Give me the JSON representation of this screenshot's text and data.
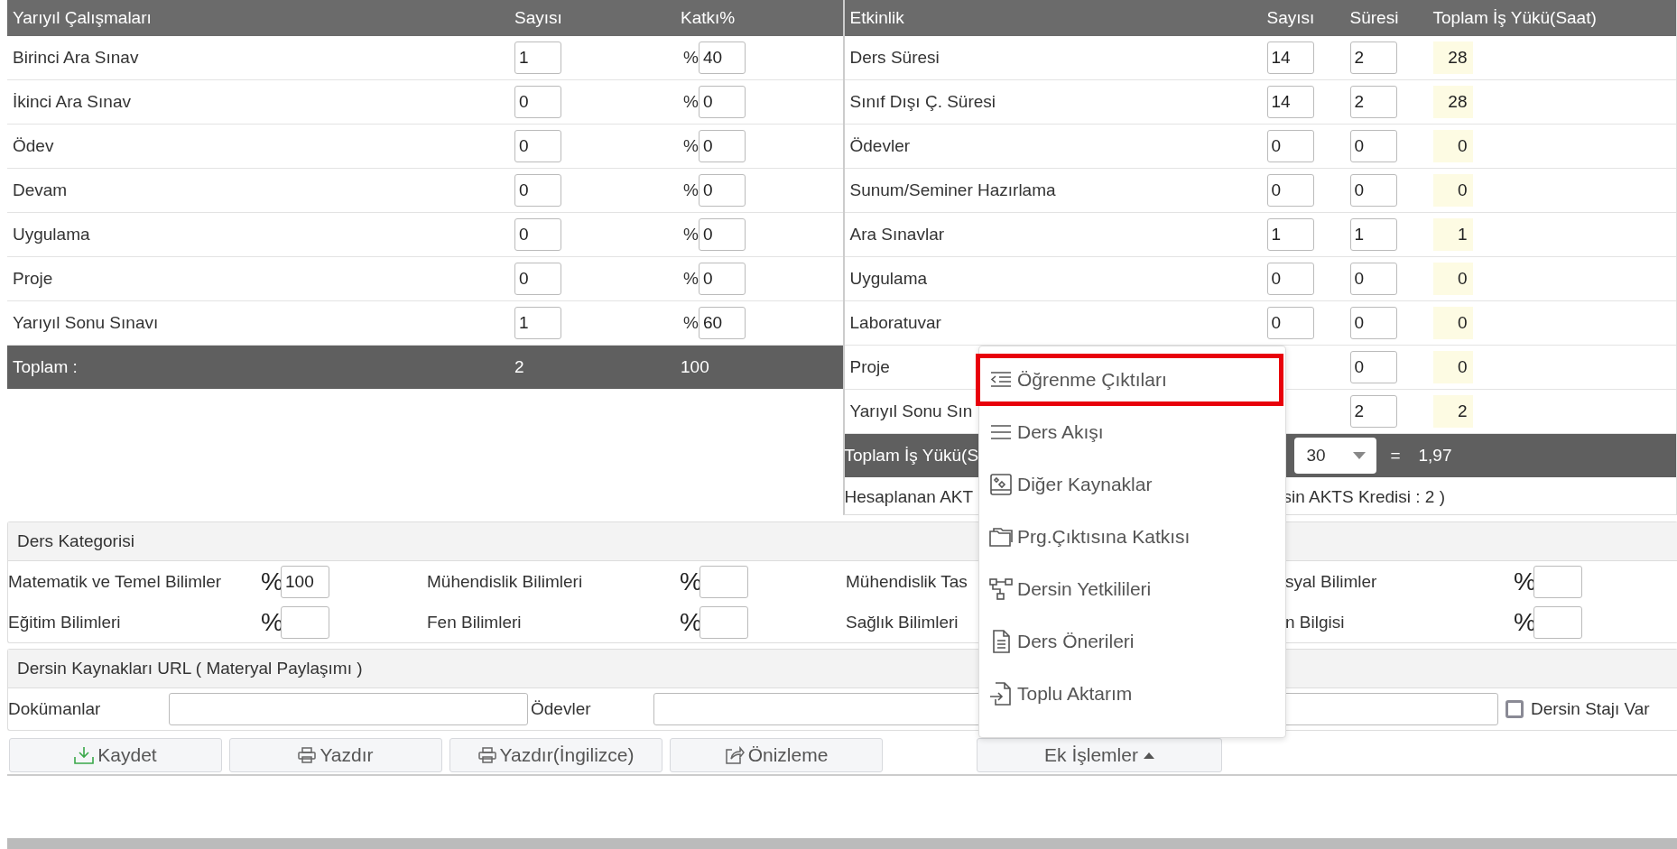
{
  "yariyil": {
    "columns": [
      "Yarıyıl Çalışmaları",
      "Sayısı",
      "Katkı%"
    ],
    "rows": [
      {
        "name": "Birinci Ara Sınav",
        "sayisi": "1",
        "katki": "40"
      },
      {
        "name": "İkinci Ara Sınav",
        "sayisi": "0",
        "katki": "0"
      },
      {
        "name": "Ödev",
        "sayisi": "0",
        "katki": "0"
      },
      {
        "name": "Devam",
        "sayisi": "0",
        "katki": "0"
      },
      {
        "name": "Uygulama",
        "sayisi": "0",
        "katki": "0"
      },
      {
        "name": "Proje",
        "sayisi": "0",
        "katki": "0"
      },
      {
        "name": "Yarıyıl Sonu Sınavı",
        "sayisi": "1",
        "katki": "60"
      }
    ],
    "percent_sign": "%",
    "total": {
      "label": "Toplam :",
      "sayisi": "2",
      "katki": "100"
    }
  },
  "etkinlik": {
    "columns": [
      "Etkinlik",
      "Sayısı",
      "Süresi",
      "Toplam İş Yükü(Saat)"
    ],
    "rows": [
      {
        "name": "Ders Süresi",
        "sayisi": "14",
        "suresi": "2",
        "toplam": "28"
      },
      {
        "name": "Sınıf Dışı Ç. Süresi",
        "sayisi": "14",
        "suresi": "2",
        "toplam": "28"
      },
      {
        "name": "Ödevler",
        "sayisi": "0",
        "suresi": "0",
        "toplam": "0"
      },
      {
        "name": "Sunum/Seminer Hazırlama",
        "sayisi": "0",
        "suresi": "0",
        "toplam": "0"
      },
      {
        "name": "Ara Sınavlar",
        "sayisi": "1",
        "suresi": "1",
        "toplam": "1"
      },
      {
        "name": "Uygulama",
        "sayisi": "0",
        "suresi": "0",
        "toplam": "0"
      },
      {
        "name": "Laboratuvar",
        "sayisi": "0",
        "suresi": "0",
        "toplam": "0"
      },
      {
        "name": "Proje",
        "suresi": "0",
        "toplam": "0"
      },
      {
        "name": "Yarıyıl Sonu Sın",
        "suresi": "2",
        "toplam": "2"
      }
    ],
    "total": {
      "label": "Toplam İş Yükü(S",
      "divisor": "30",
      "equals": "=",
      "result": "1,97"
    },
    "hesaplanan": {
      "left": "Hesaplanan AKT",
      "right": "sin AKTS Kredisi : 2 )"
    }
  },
  "ders_kategorisi": {
    "title": "Ders Kategorisi",
    "percent_sign": "%",
    "rows": [
      [
        {
          "label": "Matematik ve Temel Bilimler",
          "value": "100",
          "has_field": true
        },
        {
          "label": "Mühendislik Bilimleri",
          "has_field": true
        },
        {
          "label": "Mühendislik Tas",
          "has_field": false
        },
        {
          "label": "syal Bilimler",
          "has_field": true
        }
      ],
      [
        {
          "label": "Eğitim Bilimleri",
          "has_field": true
        },
        {
          "label": "Fen Bilimleri",
          "has_field": true
        },
        {
          "label": "Sağlık Bilimleri",
          "has_field": false
        },
        {
          "label": "n Bilgisi",
          "has_field": true
        }
      ]
    ]
  },
  "kaynaklar": {
    "title": "Dersin Kaynakları URL ( Materyal Paylaşımı )",
    "dokumanlar": "Dokümanlar",
    "odevler": "Ödevler",
    "staj": {
      "label": "Dersin Stajı Var",
      "checked": false
    }
  },
  "buttons": [
    "Kaydet",
    "Yazdır",
    "Yazdır(İngilizce)",
    "Önizleme"
  ],
  "menu_button": {
    "label": "Ek İşlemler",
    "expanded": true
  },
  "menu": [
    {
      "label": "Öğrenme Çıktıları",
      "highlighted": true
    },
    {
      "label": "Ders Akışı",
      "highlighted": false
    },
    {
      "label": "Diğer Kaynaklar",
      "highlighted": false
    },
    {
      "label": "Prg.Çıktısına Katkısı",
      "highlighted": false
    },
    {
      "label": "Dersin Yetkilileri",
      "highlighted": false
    },
    {
      "label": "Ders Önerileri",
      "highlighted": false
    },
    {
      "label": "Toplu Aktarım",
      "highlighted": false
    }
  ]
}
